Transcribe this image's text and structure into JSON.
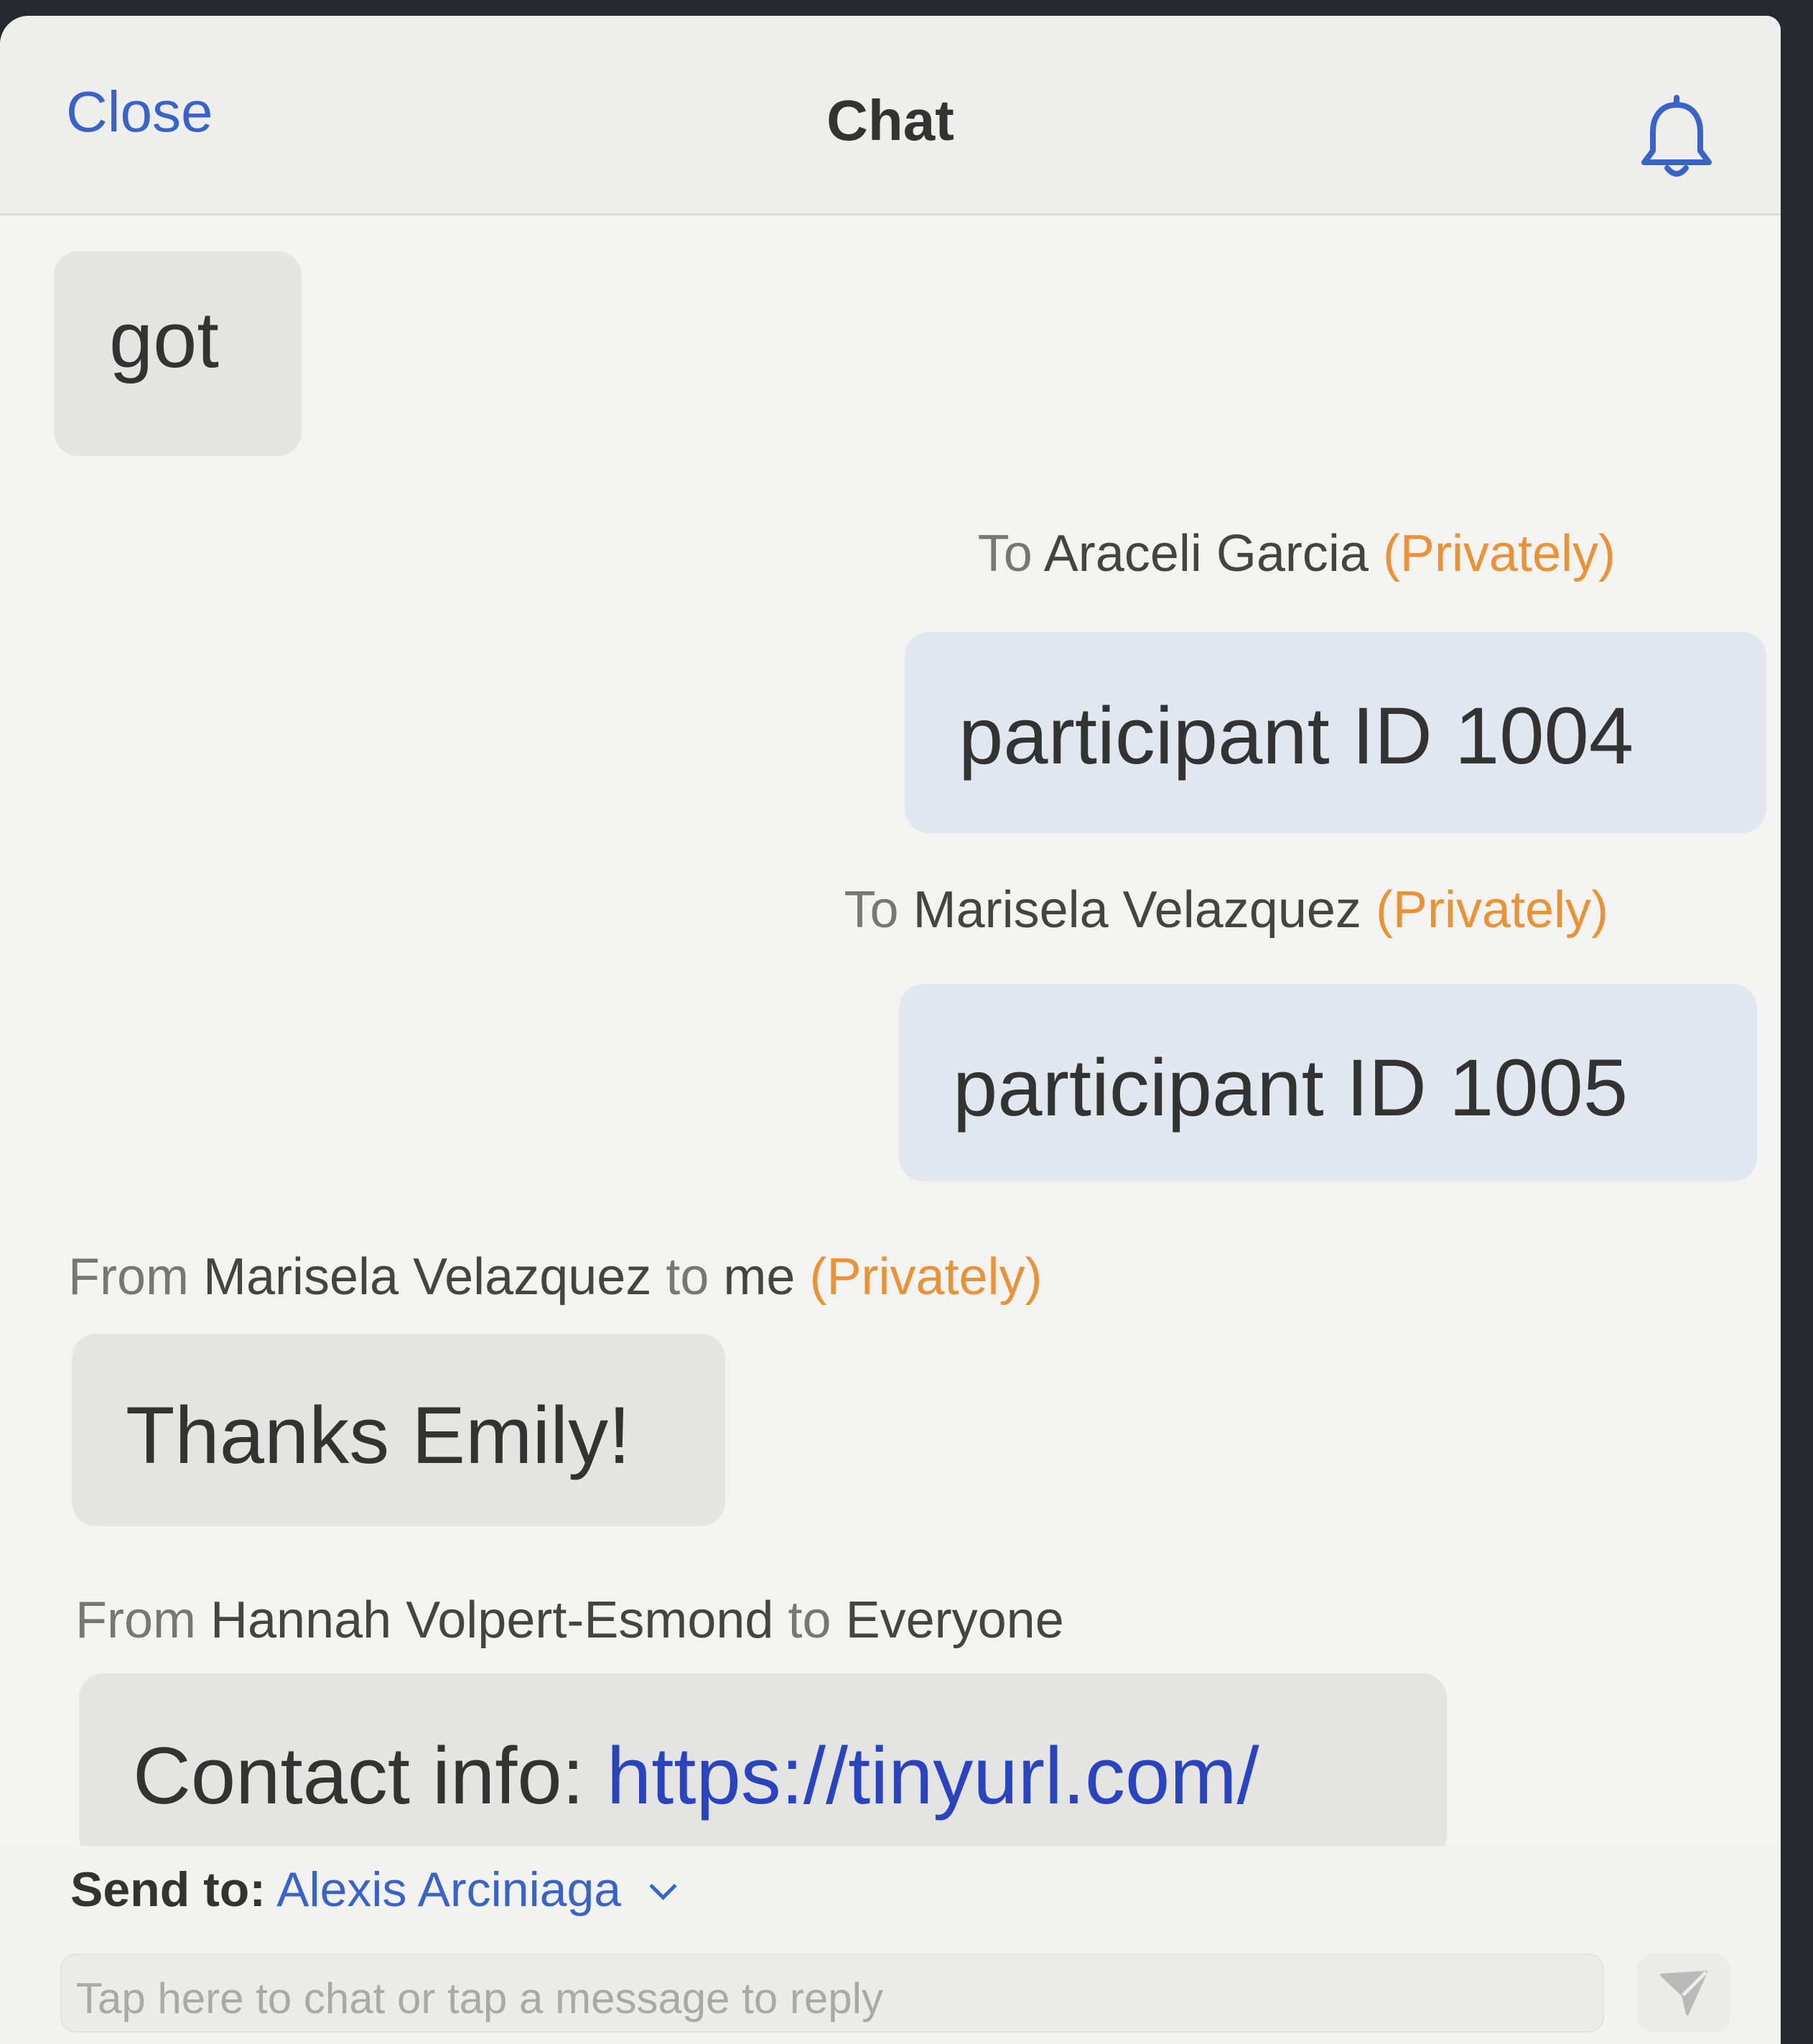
{
  "header": {
    "close_label": "Close",
    "title": "Chat",
    "bell_icon": "bell-icon"
  },
  "messages": [
    {
      "direction": "incoming",
      "text": "got"
    },
    {
      "direction": "outgoing",
      "meta": {
        "prefix": "To",
        "name": "Araceli Garcia",
        "privacy": "(Privately)"
      },
      "text": "participant ID 1004"
    },
    {
      "direction": "outgoing",
      "meta": {
        "prefix": "To",
        "name": "Marisela Velazquez",
        "privacy": "(Privately)"
      },
      "text": "participant ID 1005"
    },
    {
      "direction": "incoming",
      "meta": {
        "prefix": "From",
        "name": "Marisela Velazquez",
        "to": "to",
        "recipient": "me",
        "privacy": "(Privately)"
      },
      "text": "Thanks Emily!"
    },
    {
      "direction": "incoming",
      "meta": {
        "prefix": "From",
        "name": "Hannah Volpert-Esmond",
        "to": "to",
        "recipient": "Everyone"
      },
      "text": "Contact info:",
      "link": "https://tinyurl.com/"
    }
  ],
  "footer": {
    "send_to_label": "Send to:",
    "recipient": "Alexis Arciniaga",
    "input_placeholder": "Tap here to chat or tap a message to reply",
    "send_icon": "send-icon"
  },
  "colors": {
    "accent_blue": "#3a63c9",
    "private_orange": "#e99336",
    "link_blue": "#2a44c0"
  }
}
